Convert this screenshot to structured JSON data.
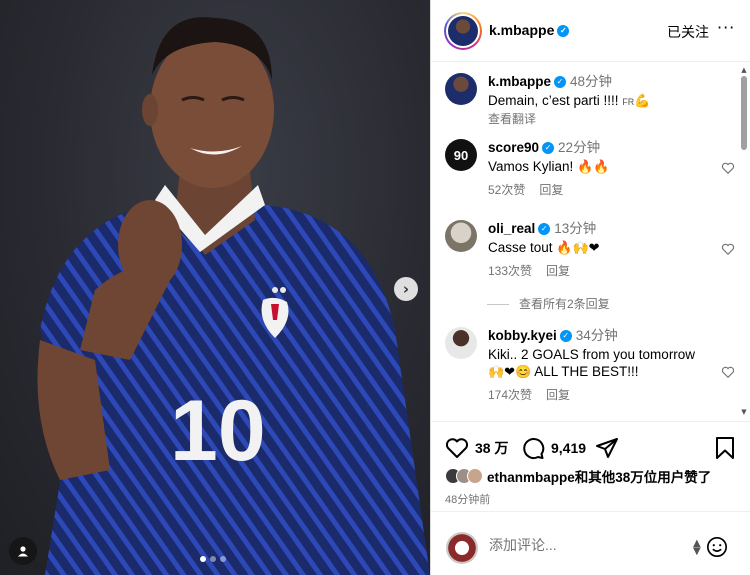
{
  "media": {
    "jersey_number": "10",
    "carousel": {
      "count": 3,
      "active": 0
    }
  },
  "header": {
    "username": "k.mbappe",
    "follow_state": "已关注",
    "more": "···"
  },
  "caption": {
    "username": "k.mbappe",
    "time": "48分钟",
    "text": "Demain, c’est parti !!!! ",
    "flag_label": "FR",
    "translate": "查看翻译"
  },
  "comments": [
    {
      "username": "score90",
      "time": "22分钟",
      "text": "Vamos Kylian! ",
      "emojis": "🔥🔥",
      "likes": "52次赞",
      "reply": "回复"
    },
    {
      "username": "oli_real",
      "time": "13分钟",
      "text": "Casse tout ",
      "emojis": "🔥🙌❤",
      "likes": "133次赞",
      "reply": "回复"
    },
    {
      "username": "kobby.kyei",
      "time": "34分钟",
      "text": "Kiki.. 2 GOALS from you tomorrow ",
      "emojis": "🙌❤😊",
      "text_after": " ALL THE BEST!!!",
      "likes": "174次赞",
      "reply": "回复"
    }
  ],
  "view_replies": "查看所有2条回复",
  "actions": {
    "likes_count": "38 万",
    "comments_count": "9,419",
    "liked_by": "ethanmbappe和其他38万位用户赞了",
    "post_time": "48分钟前"
  },
  "add_comment": {
    "placeholder": "添加评论..."
  },
  "colors": {
    "verified": "#0095f6",
    "muted_text": "#737373",
    "jersey_blue": "#1b2a6b"
  }
}
